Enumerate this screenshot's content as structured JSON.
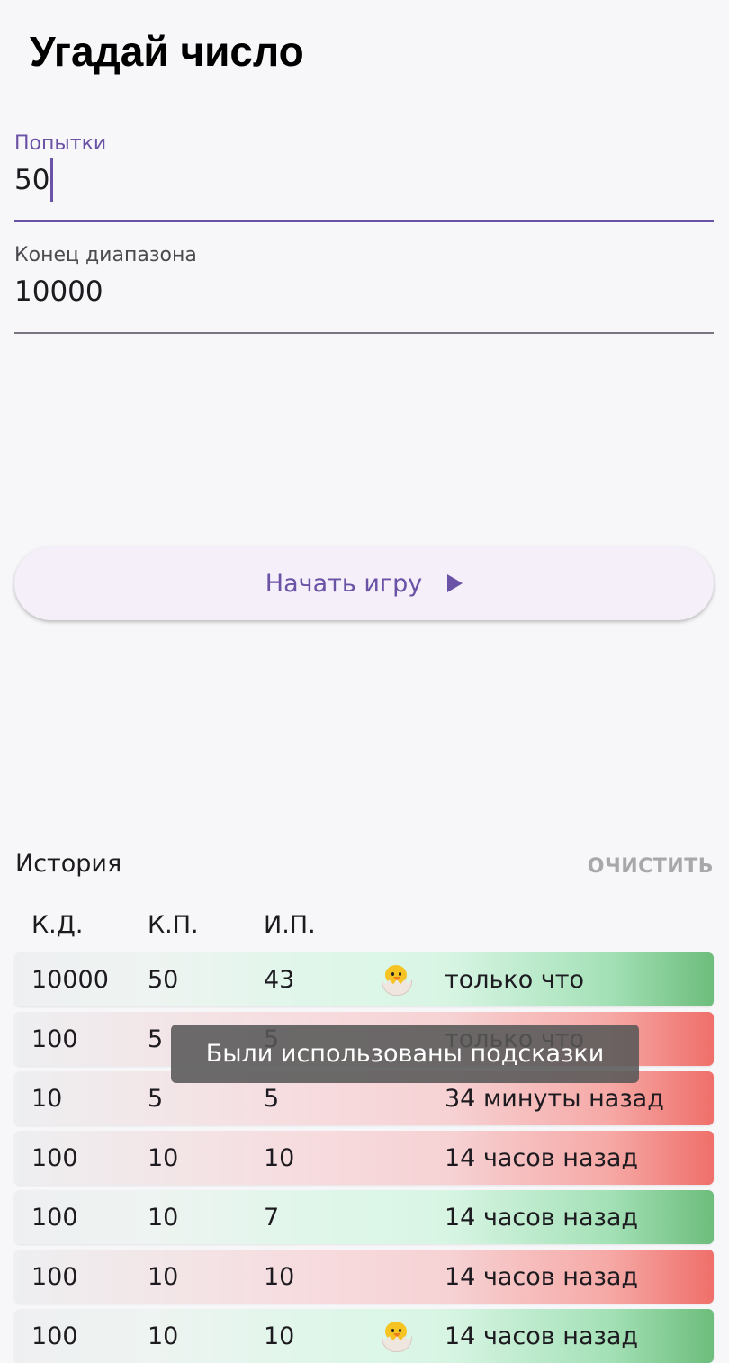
{
  "app": {
    "title": "Угадай число"
  },
  "fields": {
    "attempts": {
      "label": "Попытки",
      "value": "50"
    },
    "range_end": {
      "label": "Конец диапазона",
      "value": "10000"
    }
  },
  "start_button": {
    "label": "Начать игру",
    "icon": "play-icon"
  },
  "history": {
    "title": "История",
    "clear_label": "ОЧИСТИТЬ",
    "columns": [
      "К.Д.",
      "К.П.",
      "И.П."
    ],
    "rows": [
      {
        "range": "10000",
        "attempts": "50",
        "used": "43",
        "hint_icon": "hatching-chick-icon",
        "time": "только что",
        "status": "win"
      },
      {
        "range": "100",
        "attempts": "5",
        "used": "5",
        "hint_icon": "",
        "time": "только что",
        "status": "loss"
      },
      {
        "range": "10",
        "attempts": "5",
        "used": "5",
        "hint_icon": "",
        "time": "34 минуты назад",
        "status": "loss"
      },
      {
        "range": "100",
        "attempts": "10",
        "used": "10",
        "hint_icon": "",
        "time": "14 часов назад",
        "status": "loss"
      },
      {
        "range": "100",
        "attempts": "10",
        "used": "7",
        "hint_icon": "",
        "time": "14 часов назад",
        "status": "win"
      },
      {
        "range": "100",
        "attempts": "10",
        "used": "10",
        "hint_icon": "",
        "time": "14 часов назад",
        "status": "loss"
      },
      {
        "range": "100",
        "attempts": "10",
        "used": "10",
        "hint_icon": "hatching-chick-icon",
        "time": "14 часов назад",
        "status": "win"
      }
    ]
  },
  "toast": {
    "text": "Были использованы подсказки"
  },
  "colors": {
    "accent": "#6a52a6",
    "win": "#6dbd7c",
    "loss": "#ef6f6a"
  }
}
